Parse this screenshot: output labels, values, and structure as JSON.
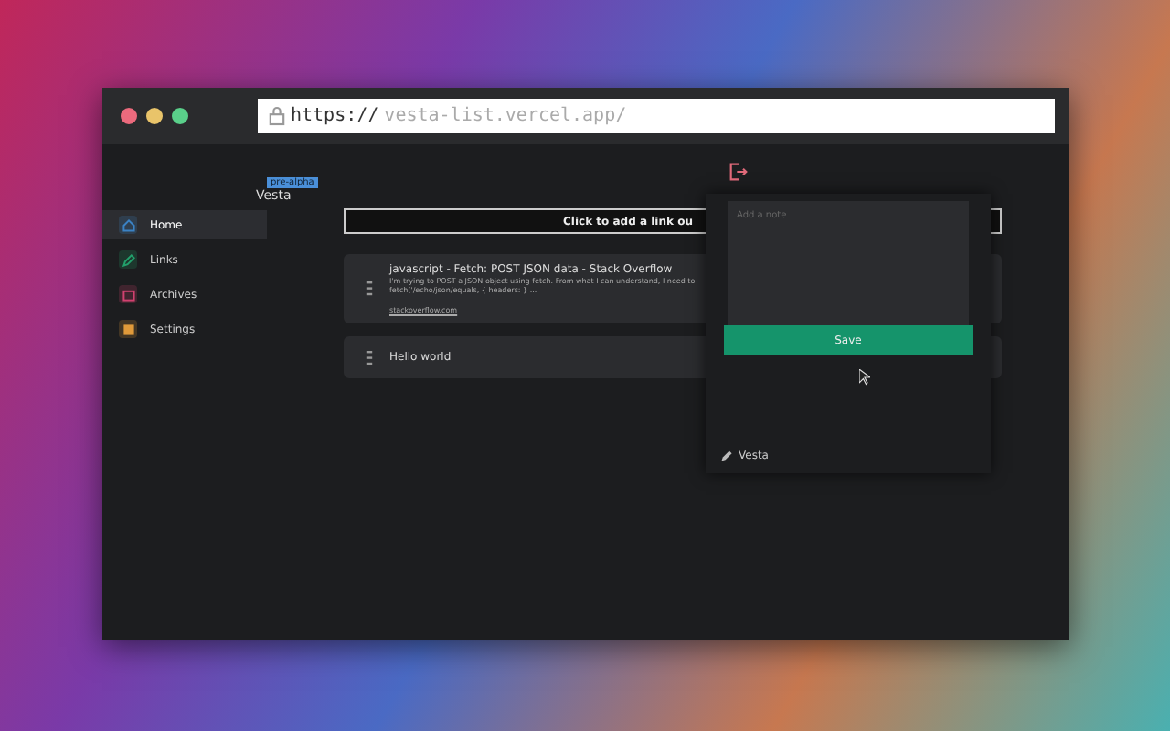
{
  "browser": {
    "url_scheme": "https://",
    "url_rest": "vesta-list.vercel.app/"
  },
  "brand": {
    "name": "Vesta",
    "badge": "pre-alpha"
  },
  "sidebar": {
    "items": [
      {
        "label": "Home",
        "color": "#3b82c4",
        "selected": true
      },
      {
        "label": "Links",
        "color": "#22a06b",
        "selected": false
      },
      {
        "label": "Archives",
        "color": "#d0416f",
        "selected": false
      },
      {
        "label": "Settings",
        "color": "#e09a3a",
        "selected": false
      }
    ]
  },
  "add_link": {
    "label": "Click to add a link ou"
  },
  "links": [
    {
      "title": "javascript - Fetch: POST JSON data - Stack Overflow",
      "description": "I'm trying to POST a JSON object using fetch. From what I can understand, I need to",
      "description_2": "fetch('/echo/json/equals, { headers: } ...",
      "domain": "stackoverflow.com"
    },
    {
      "title": "Hello world"
    }
  ],
  "popup": {
    "placeholder": "Add a note",
    "button": "Save",
    "footer": "Vesta"
  }
}
